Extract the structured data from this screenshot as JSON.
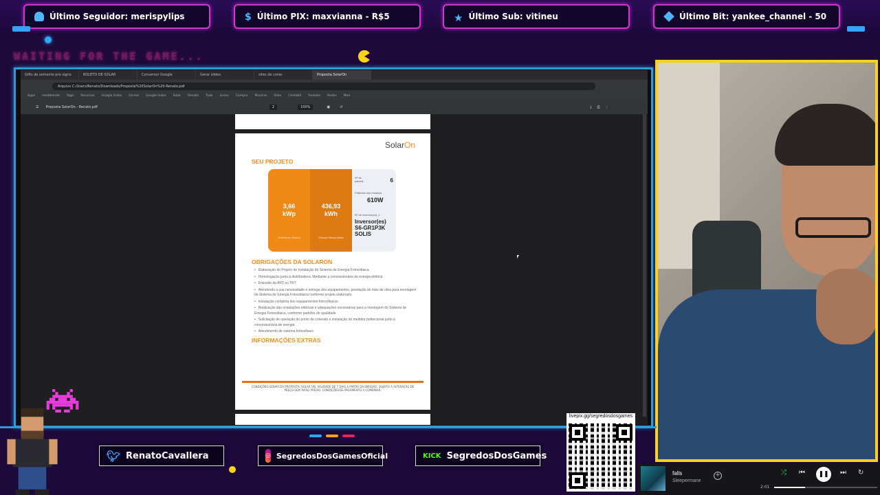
{
  "alerts": [
    {
      "label": "Último Seguidor: merispylips",
      "icon": "user-icon"
    },
    {
      "label": "Último PIX: maxvianna - R$5",
      "icon": "dollar-icon"
    },
    {
      "label": "Último Sub: vitineu",
      "icon": "star-icon"
    },
    {
      "label": "Último Bit: yankee_channel - 50",
      "icon": "diamond-icon"
    }
  ],
  "overlay": {
    "waiting_text": "WAITING FOR THE GAME..."
  },
  "browser": {
    "tabs": [
      "Gifts de semente pra signo",
      "BOLETO DE SOLAR",
      "Conversor Google",
      "Gerar slides",
      "sites de cores",
      "Proposta SolarOn"
    ],
    "address": "Arquivo  C:/Users/Renato/Downloads/Proposta%20SolarOn%20-Renato.pdf",
    "bookmarks": [
      "Apps",
      "nerdblonde",
      "Yago",
      "Recursos",
      "Google Index",
      "Unreal",
      "Google Index",
      "Solar",
      "Renato",
      "Tudo",
      "Livros",
      "Compra",
      "Musicas",
      "Sites",
      "Contabil",
      "Youtube",
      "Redes",
      "Mod"
    ],
    "pdf_filename": "Proposta SolarOn - Renato.pdf",
    "page_indicator": "2",
    "zoom": "100%"
  },
  "pdf_page": {
    "logo_text": "Solar",
    "logo_accent": "On",
    "section_project": "SEU PROJETO",
    "power_value": "3,66\nkWp",
    "power_caption": "Potência do Sistema",
    "energy_value": "436,93\nkWh",
    "energy_caption": "Geração Mensal Média",
    "panels_label": "Nº de\npainéis",
    "panels_value": "6",
    "module_label": "Potência dos módulos",
    "module_value": "610W",
    "inverter_label": "Nº de inversor(es): 1",
    "inverter_value": "Inversor(es)\nS6-GR1P3K\nSOLIS",
    "section_obligations": "OBRIGAÇÕES DA SOLARON",
    "obligations": [
      "Elaboração do Projeto de Instalação do Sistema de Energia Fotovoltaica",
      "Homologação junto à distribuidora. Mediante a concessionária de energia elétrica",
      "Emissão da ART ou TRT",
      "Atendendo a sua necessidade e entrega dos equipamentos, prestação de mão de obra para montagem do Sistema de Energia Fotovoltaica conforme projeto elaborado",
      "Instalação completa dos equipamentos fotovoltaicos",
      "Realização das instalações elétricas e adequações necessárias para a montagem do Sistema de Energia Fotovoltaica, conforme padrões de qualidade",
      "Solicitação de operação do ponto de conexão e instalação do medidor bidirecional junto à concessionária de energia",
      "Atendimento de sistema fotovoltaico"
    ],
    "section_extras": "INFORMAÇÕES EXTRAS",
    "footer": "CONDIÇÕES GERAIS DA PROPOSTA: SOLAR ON. VALIDADE DE 7 DIAS A PARTIR DA EMISSÃO. SUJEITO A ALTERAÇÃO DE PREÇO SEM AVISO PRÉVIO. CONDIÇÕES DE PAGAMENTO A COMBINAR."
  },
  "socials": [
    {
      "handle": "RenatoCavallera",
      "icon": "twitter-icon"
    },
    {
      "handle": "SegredosDosGamesOficial",
      "icon": "instagram-icon"
    },
    {
      "handle": "SegredosDosGames",
      "icon": "kick-icon",
      "icon_text": "KICK"
    }
  ],
  "qr": {
    "url_label": "livepix.gg/segredosdosgames"
  },
  "player": {
    "title": "falls",
    "artist": "Sleepermane",
    "elapsed": "2:01",
    "progress": 0.3
  },
  "colors": {
    "alert_border": "#d238c8",
    "frame_border": "#2e9ad8",
    "webcam_border": "#ffd21a",
    "accent_orange": "#f28c1c"
  }
}
